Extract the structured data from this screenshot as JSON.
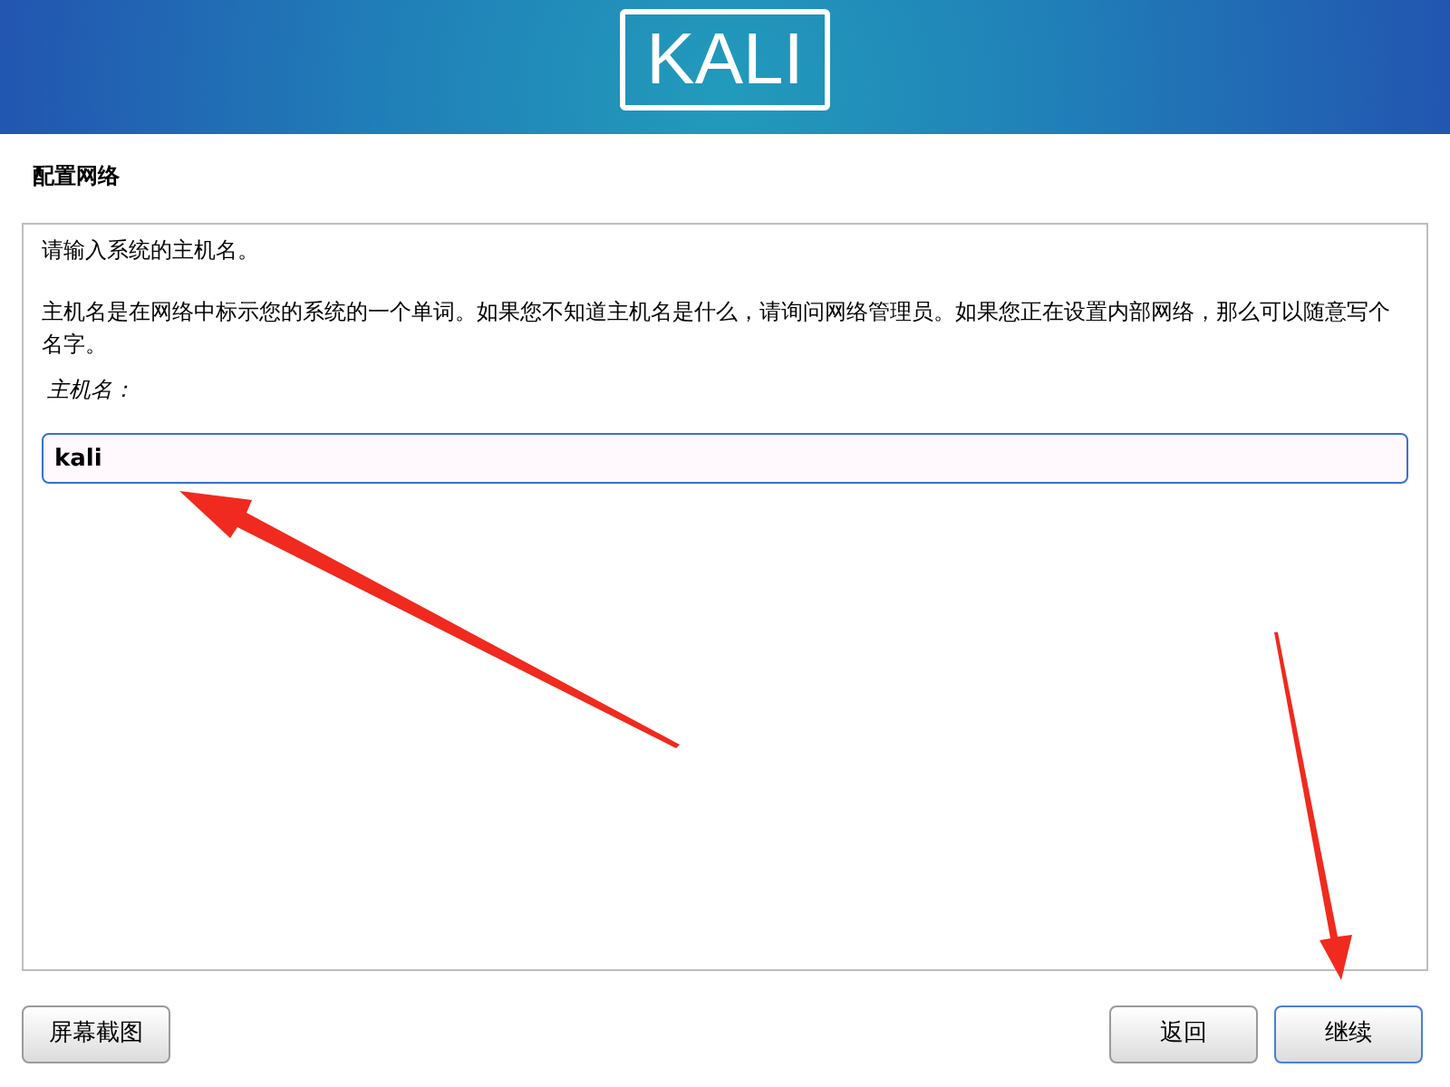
{
  "header": {
    "logo_text": "KALI"
  },
  "page_title": "配置网络",
  "content": {
    "intro": "请输入系统的主机名。",
    "description": "主机名是在网络中标示您的系统的一个单词。如果您不知道主机名是什么，请询问网络管理员。如果您正在设置内部网络，那么可以随意写个名字。",
    "field_label": "主机名：",
    "field_value": "kali"
  },
  "buttons": [
    {
      "label": "屏幕截图",
      "kind": "left",
      "selected": false
    },
    {
      "label": "返回",
      "kind": "right",
      "selected": false
    },
    {
      "label": "继续",
      "kind": "right",
      "selected": true
    }
  ]
}
